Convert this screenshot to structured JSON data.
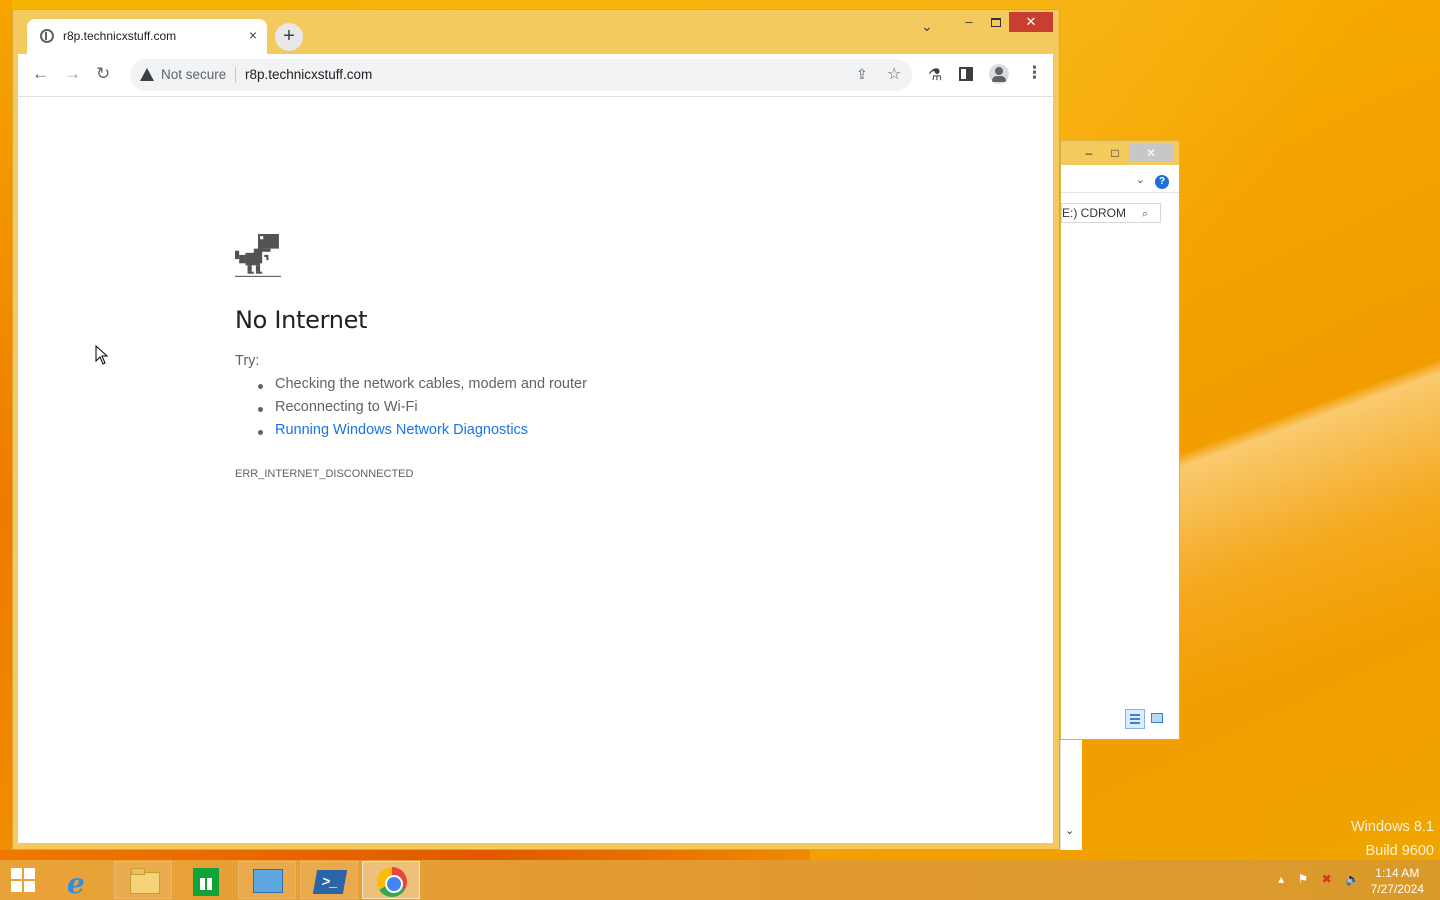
{
  "browser": {
    "tab_title": "r8p.technicxstuff.com",
    "tab_close": "×",
    "new_tab": "+",
    "tab_search": "⌄",
    "window_minimize": "–",
    "window_close": "✕",
    "nav": {
      "back": "←",
      "forward": "→",
      "reload": "↻"
    },
    "omnibox": {
      "security_label": "Not secure",
      "url": "r8p.technicxstuff.com"
    },
    "icons": {
      "share": "⇪",
      "star": "☆",
      "extensions": "⚗",
      "menu": "⋮"
    }
  },
  "error_page": {
    "title": "No Internet",
    "try_label": "Try:",
    "suggestions": [
      "Checking the network cables, modem and router",
      "Reconnecting to Wi-Fi",
      "Running Windows Network Diagnostics"
    ],
    "error_code": "ERR_INTERNET_DISCONNECTED"
  },
  "explorer": {
    "minimize": "–",
    "maximize": "□",
    "close": "✕",
    "help": "?",
    "path_text": "E:) CDROM",
    "chevron": "⌄",
    "search": "⌕",
    "scroll_down": "⌄"
  },
  "taskbar": {
    "powershell_glyph": ">_",
    "ie_glyph": "e",
    "tray_arrow": "▴",
    "tray_flag": "⚑",
    "tray_network": "✖",
    "tray_volume": "🔈",
    "time": "1:14 AM",
    "date": "7/27/2024"
  },
  "watermark": {
    "line1": "Windows 8.1",
    "line2": "Build 9600"
  }
}
